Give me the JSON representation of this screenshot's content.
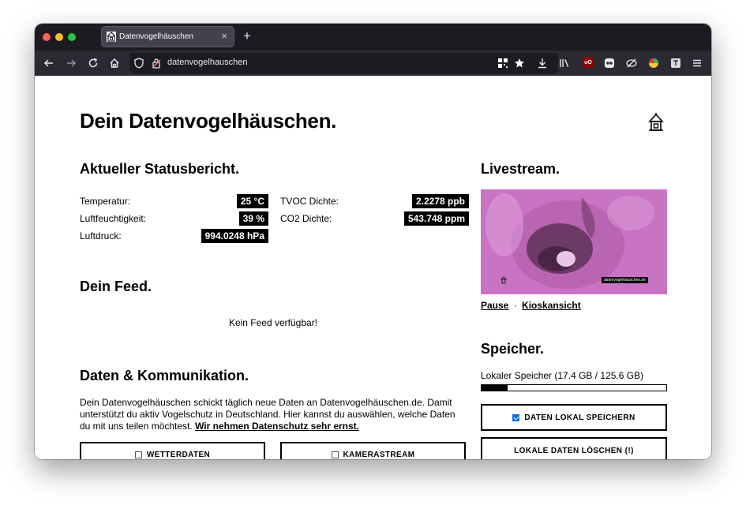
{
  "browser": {
    "tab_title": "Datenvogelhäuschen",
    "tab_close": "×",
    "new_tab": "+",
    "url": "datenvogelhauschen",
    "ublock_label": "uO"
  },
  "page": {
    "title": "Dein Datenvogelhäuschen."
  },
  "status": {
    "heading": "Aktueller Statusbericht.",
    "rows": [
      {
        "label": "Temperatur:",
        "value": "25 °C"
      },
      {
        "label": "Luftfeuchtigkeit:",
        "value": "39 %"
      },
      {
        "label": "Luftdruck:",
        "value": "994.0248 hPa"
      },
      {
        "label": "TVOC Dichte:",
        "value": "2.2278 ppb"
      },
      {
        "label": "CO2 Dichte:",
        "value": "543.748 ppm"
      }
    ]
  },
  "feed": {
    "heading": "Dein Feed.",
    "empty": "Kein Feed verfügbar!"
  },
  "data_comm": {
    "heading": "Daten & Kommunikation.",
    "text": "Dein Datenvogelhäuschen schickt täglich neue Daten an Datenvogelhäuschen.de. Damit unterstützt du aktiv Vogelschutz in Deutschland. Hier kannst du auswählen, welche Daten du mit uns teilen möchtest. ",
    "link": "Wir nehmen Datenschutz sehr ernst.",
    "buttons": {
      "weather": "WETTERDATEN",
      "camera": "KAMERASTREAM"
    }
  },
  "livestream": {
    "heading": "Livestream.",
    "watermark": "datenvogelhäuschen.de",
    "pause": "Pause",
    "separator": "·",
    "kiosk": "Kioskansicht"
  },
  "storage": {
    "heading": "Speicher.",
    "label": "Lokaler Speicher (17.4 GB / 125.6 GB)",
    "used_fraction": 0.14,
    "save_locally": "DATEN LOKAL SPEICHERN",
    "save_locally_checked": true,
    "delete_local": "LOKALE DATEN LÖSCHEN (!)"
  }
}
